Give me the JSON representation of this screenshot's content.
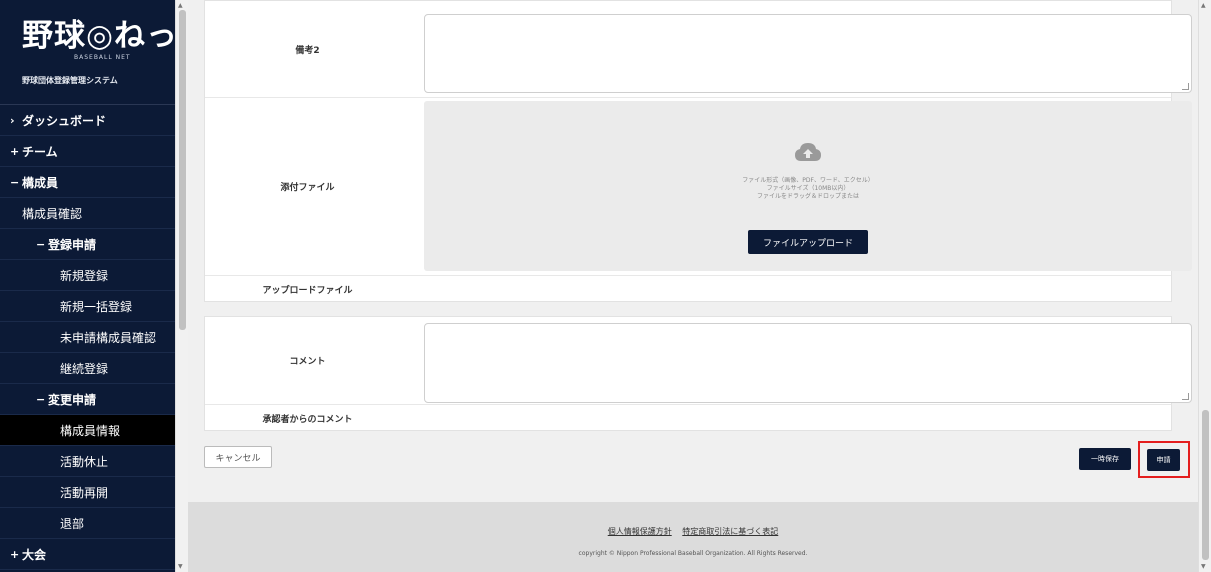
{
  "sidebar": {
    "logo_main": "野球◎ねっと",
    "logo_eng": "BASEBALL NET",
    "logo_sub": "野球団体登録管理システム",
    "items": [
      {
        "sym": "›",
        "label": "ダッシュボード"
      },
      {
        "sym": "+",
        "label": "チーム"
      },
      {
        "sym": "−",
        "label": "構成員"
      },
      {
        "label": "構成員確認"
      },
      {
        "sym": "−",
        "label": "登録申請"
      },
      {
        "label": "新規登録"
      },
      {
        "label": "新規一括登録"
      },
      {
        "label": "未申請構成員確認"
      },
      {
        "label": "継続登録"
      },
      {
        "sym": "−",
        "label": "変更申請"
      },
      {
        "label": "構成員情報"
      },
      {
        "label": "活動休止"
      },
      {
        "label": "活動再開"
      },
      {
        "label": "退部"
      },
      {
        "sym": "+",
        "label": "大会"
      }
    ]
  },
  "form": {
    "remarks2_label": "備考2",
    "attachment_label": "添付ファイル",
    "dropzone_line1": "ファイル形式（画像、PDF、ワード、エクセル）",
    "dropzone_line2": "ファイルサイズ（10MB以内）",
    "dropzone_line3": "ファイルをドラッグ＆ドロップまたは",
    "upload_button": "ファイルアップロード",
    "uploaded_files_label": "アップロードファイル",
    "comment_label": "コメント",
    "approver_comment_label": "承認者からのコメント"
  },
  "actions": {
    "cancel": "キャンセル",
    "temp_save": "一時保存",
    "apply": "申請"
  },
  "footer": {
    "link_privacy": "個人情報保護方針",
    "link_law": "特定商取引法に基づく表記",
    "copyright": "copyright © Nippon Professional Baseball Organization. All Rights Reserved."
  },
  "colors": {
    "sidebar_bg": "#0c1a36",
    "button_bg": "#0c1a36",
    "highlight": "#e41e1e"
  }
}
